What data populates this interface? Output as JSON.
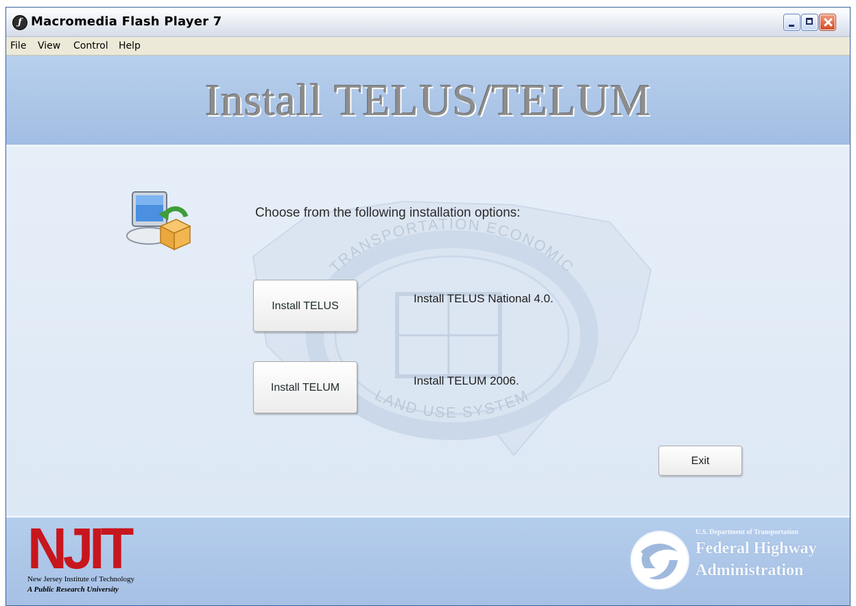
{
  "window": {
    "title": "Macromedia Flash Player 7",
    "controls": [
      "minimize-icon",
      "maximize-icon",
      "close-icon"
    ]
  },
  "menu": {
    "items": [
      {
        "label": "File"
      },
      {
        "label": "View"
      },
      {
        "label": "Control"
      },
      {
        "label": "Help"
      }
    ]
  },
  "header": {
    "title": "Install TELUS/TELUM"
  },
  "main": {
    "prompt": "Choose from the following installation options:",
    "watermark_text": {
      "top": "TRANSPORTATION ECONOMIC",
      "bottom": "LAND USE SYSTEM"
    },
    "options": [
      {
        "button_label": "Install TELUS",
        "description": "Install TELUS National 4.0."
      },
      {
        "button_label": "Install TELUM",
        "description": "Install TELUM 2006."
      }
    ],
    "exit_label": "Exit"
  },
  "footer": {
    "njit": {
      "letters": "NJIT",
      "line1": "New Jersey Institute of Technology",
      "line2": "A Public Research University"
    },
    "fhwa": {
      "dept": "U.S. Department of Transportation",
      "name_line1": "Federal Highway",
      "name_line2": "Administration"
    }
  },
  "colors": {
    "header_band": "#b8d0ed",
    "main_background": "#e6eef8",
    "njit_red": "#c7161d",
    "title_gray": "#8d8d8d"
  }
}
